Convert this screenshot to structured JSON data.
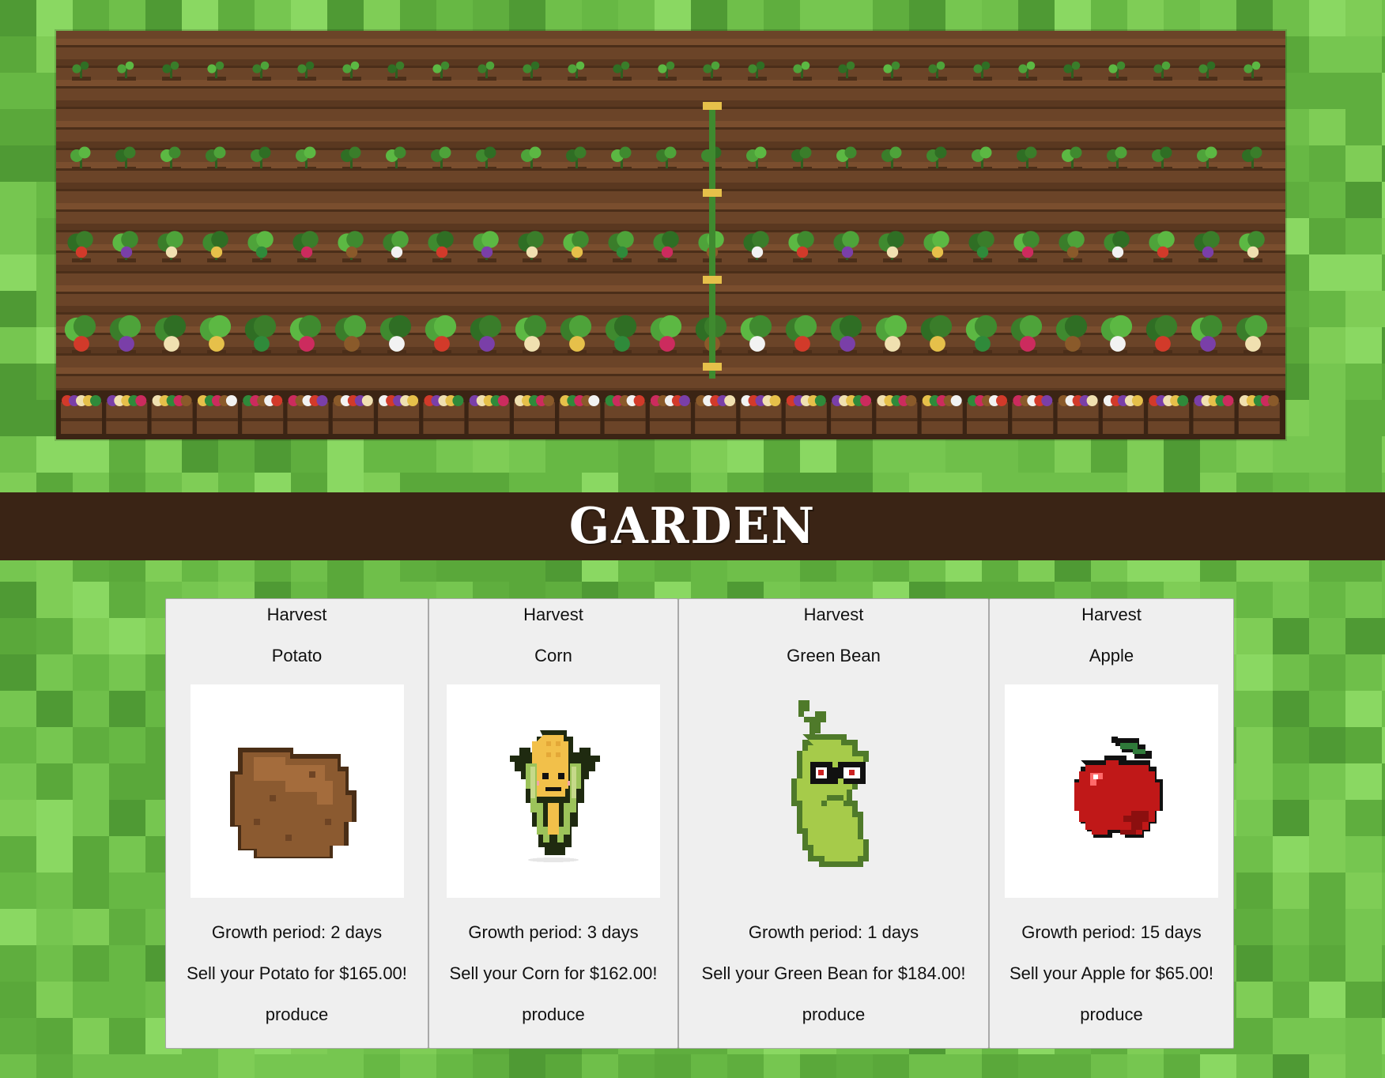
{
  "page": {
    "title": "GARDEN"
  },
  "colors": {
    "grass": "#6fbf4a",
    "title_bar": "#3a2415",
    "soil": "#6b4428",
    "card_bg": "#efefef"
  },
  "crops": [
    {
      "harvest_label": "Harvest",
      "name": "Potato",
      "icon": "potato-icon",
      "growth": "Growth period: 2 days",
      "sell": "Sell your Potato for $165.00!",
      "category": "produce"
    },
    {
      "harvest_label": "Harvest",
      "name": "Corn",
      "icon": "corn-icon",
      "growth": "Growth period: 3 days",
      "sell": "Sell your Corn for $162.00!",
      "category": "produce"
    },
    {
      "harvest_label": "Harvest",
      "name": "Green Bean",
      "icon": "green-bean-icon",
      "growth": "Growth period: 1 days",
      "sell": "Sell your Green Bean for $184.00!",
      "category": "produce"
    },
    {
      "harvest_label": "Harvest",
      "name": "Apple",
      "icon": "apple-icon",
      "growth": "Growth period: 15 days",
      "sell": "Sell your Apple for $65.00!",
      "category": "produce"
    }
  ]
}
